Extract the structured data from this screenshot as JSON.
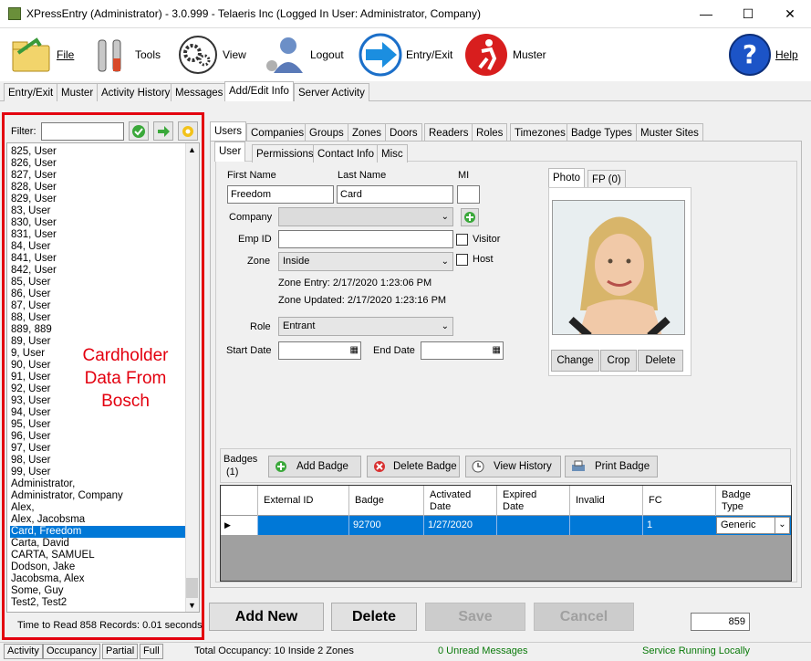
{
  "window": {
    "title": "XPressEntry (Administrator)  - 3.0.999 - Telaeris Inc (Logged In User: Administrator, Company)",
    "min": "—",
    "max": "☐",
    "close": "✕"
  },
  "toolbar": {
    "file": "File",
    "tools": "Tools",
    "view": "View",
    "logout": "Logout",
    "entry_exit": "Entry/Exit",
    "muster": "Muster",
    "help": "Help"
  },
  "main_tabs": [
    "Entry/Exit",
    "Muster",
    "Activity History",
    "Messages",
    "Add/Edit Info",
    "Server Activity"
  ],
  "left": {
    "filter_label": "Filter:",
    "filter_value": "",
    "items": [
      "825, User",
      "826, User",
      "827, User",
      "828, User",
      "829, User",
      "83, User",
      "830, User",
      "831, User",
      "84, User",
      "841, User",
      "842, User",
      "85, User",
      "86, User",
      "87, User",
      "88, User",
      "889, 889",
      "89, User",
      "9, User",
      "90, User",
      "91, User",
      "92, User",
      "93, User",
      "94, User",
      "95, User",
      "96, User",
      "97, User",
      "98, User",
      "99, User",
      "Administrator,",
      "Administrator, Company",
      "Alex,",
      "Alex, Jacobsma",
      "Card, Freedom",
      "Carta, David",
      "CARTA, SAMUEL",
      "Dodson, Jake",
      "Jacobsma, Alex",
      "Some, Guy",
      "Test2, Test2"
    ],
    "selected_index": 32,
    "annotation_line1": "Cardholder",
    "annotation_line2": "Data From",
    "annotation_line3": "Bosch",
    "time_info": "Time to Read 858 Records: 0.01 seconds"
  },
  "entity_tabs": [
    "Users",
    "Companies",
    "Groups",
    "Zones",
    "Doors",
    "Readers",
    "Roles",
    "Timezones",
    "Badge Types",
    "Muster Sites"
  ],
  "user_tabs": [
    "User",
    "Permissions",
    "Contact Info",
    "Misc"
  ],
  "form": {
    "first_name_label": "First Name",
    "first_name": "Freedom",
    "last_name_label": "Last Name",
    "last_name": "Card",
    "mi_label": "MI",
    "mi": "",
    "company_label": "Company",
    "company": "",
    "emp_id_label": "Emp ID",
    "emp_id": "",
    "visitor_label": "Visitor",
    "host_label": "Host",
    "zone_label": "Zone",
    "zone": "Inside",
    "zone_entry": "Zone Entry: 2/17/2020 1:23:06 PM",
    "zone_updated": "Zone Updated: 2/17/2020 1:23:16 PM",
    "role_label": "Role",
    "role": "Entrant",
    "start_date_label": "Start Date",
    "start_date": "",
    "end_date_label": "End Date",
    "end_date": ""
  },
  "photo": {
    "tabs": [
      "Photo",
      "FP (0)"
    ],
    "change": "Change",
    "crop": "Crop",
    "delete": "Delete"
  },
  "badges": {
    "label": "Badges",
    "count": "(1)",
    "add": "Add Badge",
    "delete": "Delete Badge",
    "history": "View History",
    "print": "Print Badge",
    "columns": [
      "External ID",
      "Badge",
      "Activated Date",
      "Expired Date",
      "Invalid",
      "FC",
      "Badge Type"
    ],
    "rows": [
      {
        "external_id": "",
        "badge": "92700",
        "activated": "1/27/2020",
        "expired": "",
        "invalid": "",
        "fc": "1",
        "type": "Generic"
      }
    ]
  },
  "actions": {
    "add_new": "Add New",
    "delete": "Delete",
    "save": "Save",
    "cancel": "Cancel",
    "count": "859"
  },
  "status": {
    "tabs": [
      "Activity",
      "Occupancy",
      "Partial",
      "Full"
    ],
    "occupancy": "Total Occupancy: 10 Inside 2 Zones",
    "messages": "0 Unread Messages",
    "service": "Service Running Locally"
  },
  "colors": {
    "accent": "#0078d7",
    "annotation": "#e3000f",
    "service_green": "#0a7a0a"
  }
}
